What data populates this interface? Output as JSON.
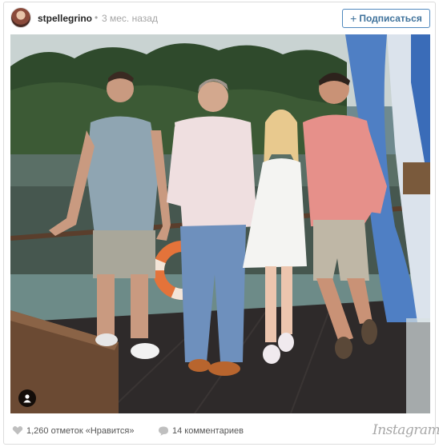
{
  "post": {
    "username": "stpellegrino",
    "separator": "•",
    "time_ago": "3 мес. назад",
    "follow_label": "Подписаться",
    "follow_plus": "+"
  },
  "photo": {
    "user_tag_icon": "person-icon"
  },
  "footer": {
    "likes_icon": "heart-icon",
    "likes_text": "1,260 отметок «Нравится»",
    "comments_icon": "comment-icon",
    "comments_text": "14 комментариев",
    "brand": "Instagram"
  },
  "colors": {
    "accent": "#3f729b",
    "follow_border": "#4f88bd",
    "muted_text": "#a5a5a5"
  }
}
